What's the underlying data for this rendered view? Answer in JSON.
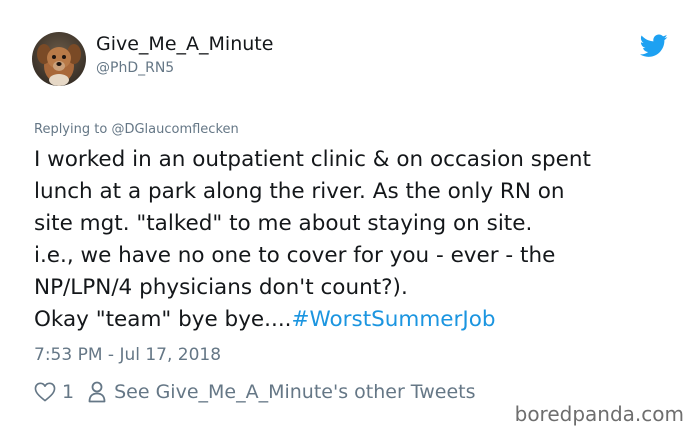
{
  "user": {
    "display_name": "Give_Me_A_Minute",
    "handle": "@PhD_RN5",
    "avatar_icon": "dog-photo-avatar"
  },
  "reply": {
    "prefix": "Replying to",
    "mention": "@DGlaucomflecken"
  },
  "tweet": {
    "lines": [
      "I worked in an outpatient clinic &  on occasion spent",
      "lunch at a park along the river. As the only RN on",
      "site mgt. \"talked\" to me about staying on site.",
      "i.e., we have no one to cover for you - ever - the",
      "NP/LPN/4 physicians don't count?).",
      "Okay \"team\" bye bye...."
    ],
    "hashtag": "#WorstSummerJob"
  },
  "timestamp": "7:53 PM - Jul 17, 2018",
  "actions": {
    "like_count": "1",
    "other_tweets_label": "See Give_Me_A_Minute's other Tweets"
  },
  "watermark": "boredpanda.com",
  "colors": {
    "link": "#1b95e0",
    "muted": "#657786",
    "text": "#14171a",
    "twitter_bird": "#1da1f2"
  }
}
